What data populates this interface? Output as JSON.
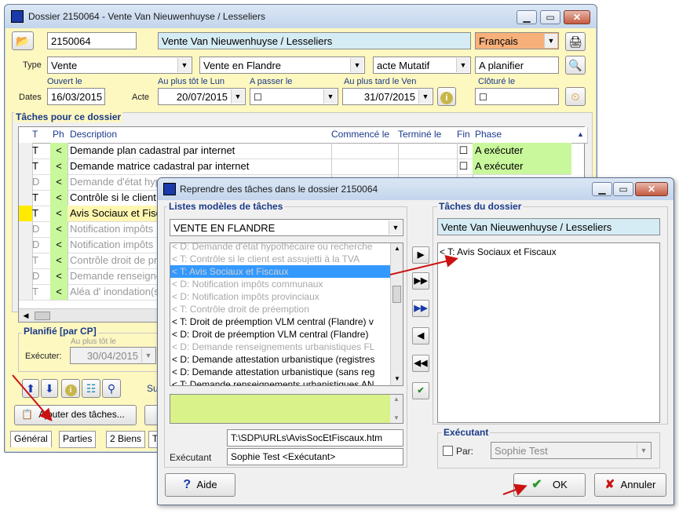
{
  "main_window": {
    "title": "Dossier 2150064 - Vente Van Nieuwenhuyse / Lesseliers",
    "dossier_number": "2150064",
    "dossier_name": "Vente Van Nieuwenhuyse / Lesseliers",
    "language": "Français",
    "type_label": "Type",
    "type_value": "Vente",
    "subtype_value": "Vente en Flandre",
    "acte_type_value": "acte Mutatif",
    "status_value": "A planifier",
    "dates_label": "Dates",
    "acte_label": "Acte",
    "ouvert_le_label": "Ouvert le",
    "ouvert_le_value": "16/03/2015",
    "au_plus_tot_label": "Au plus tôt le Lun",
    "au_plus_tot_value": "20/07/2015",
    "a_passer_label": "A passer le",
    "au_plus_tard_label": "Au plus tard le Ven",
    "au_plus_tard_value": "31/07/2015",
    "cloture_label": "Clôturé le",
    "taches_group_title": "Tâches pour ce dossier",
    "columns": [
      "T",
      "Ph",
      "Description",
      "Commencé le",
      "Terminé le",
      "Fin",
      "Phase"
    ],
    "rows": [
      {
        "t": "T",
        "ph": "<",
        "desc": "Demande plan cadastral par internet",
        "fin": "☐",
        "phase": "A exécuter",
        "disabled": false
      },
      {
        "t": "T",
        "ph": "<",
        "desc": "Demande matrice cadastral par internet",
        "fin": "☐",
        "phase": "A exécuter",
        "disabled": false
      },
      {
        "t": "D",
        "ph": "<",
        "desc": "Demande d'état hyp",
        "fin": "",
        "phase": "",
        "disabled": true
      },
      {
        "t": "T",
        "ph": "<",
        "desc": "Contrôle si le client",
        "fin": "",
        "phase": "",
        "disabled": false
      },
      {
        "t": "T",
        "ph": "<",
        "desc": "Avis Sociaux et Fisc",
        "fin": "",
        "phase": "",
        "disabled": false
      },
      {
        "t": "D",
        "ph": "<",
        "desc": "Notification impôts",
        "fin": "",
        "phase": "",
        "disabled": true
      },
      {
        "t": "D",
        "ph": "<",
        "desc": "Notification impôts",
        "fin": "",
        "phase": "",
        "disabled": true
      },
      {
        "t": "T",
        "ph": "<",
        "desc": "Contrôle droit de pre",
        "fin": "",
        "phase": "",
        "disabled": true
      },
      {
        "t": "D",
        "ph": "<",
        "desc": "Demande renseignem",
        "fin": "",
        "phase": "",
        "disabled": true
      },
      {
        "t": "T",
        "ph": "<",
        "desc": "Aléa d' inondation(s",
        "fin": "",
        "phase": "",
        "disabled": true
      }
    ],
    "planifie_title": "Planifié  [par CP]",
    "au_plus_tot_small": "Au plus tôt le",
    "executer_label": "Exécuter:",
    "executer_value": "30/04/2015",
    "su_label": "Su",
    "ajouter_button": "Ajouter des tâches...",
    "tabs": [
      "Général",
      "Parties",
      "2 Biens",
      "Ta"
    ]
  },
  "dialog": {
    "title": "Reprendre des tâches dans le dossier 2150064",
    "listes_title": "Listes modèles de tâches",
    "model_select": "VENTE EN FLANDRE",
    "model_items": [
      {
        "text": "< D: Demande d'état hypothécaire ou recherche",
        "state": "dis"
      },
      {
        "text": "< T: Contrôle si le client est assujetti à la TVA",
        "state": "dis"
      },
      {
        "text": "< T: Avis Sociaux et Fiscaux",
        "state": "sel"
      },
      {
        "text": "< D: Notification impôts communaux",
        "state": "dis"
      },
      {
        "text": "< D: Notification impôts provinciaux",
        "state": "dis"
      },
      {
        "text": "< T: Contrôle droit de préemption",
        "state": "dis"
      },
      {
        "text": "< T: Droit de préemption VLM central (Flandre) v",
        "state": "en"
      },
      {
        "text": "< D: Droit de préemption VLM central (Flandre)",
        "state": "en"
      },
      {
        "text": "< D: Demande renseignements urbanistiques FL",
        "state": "dis"
      },
      {
        "text": "< D: Demande attestation urbanistique (registres",
        "state": "en"
      },
      {
        "text": "< D: Demande attestation urbanistique (sans reg",
        "state": "en"
      },
      {
        "text": "< T: Demande renseignements urbanistiques AN",
        "state": "en"
      }
    ],
    "file_path": "T:\\SDP\\URLs\\AvisSocEtFiscaux.htm",
    "executant_label": "Exécutant",
    "executant_value": "Sophie Test <Exécutant>",
    "taches_dossier_title": "Tâches du dossier",
    "dossier_name": "Vente Van Nieuwenhuyse / Lesseliers",
    "dossier_tasks": [
      "< T: Avis Sociaux et Fiscaux"
    ],
    "executant_group_title": "Exécutant",
    "par_label": "Par:",
    "par_value": "Sophie Test",
    "aide_button": "Aide",
    "ok_button": "OK",
    "annuler_button": "Annuler"
  },
  "colors": {
    "accent_red": "#cc1111",
    "highlight_green": "#c9f79c",
    "selection_blue": "#3399ff"
  }
}
